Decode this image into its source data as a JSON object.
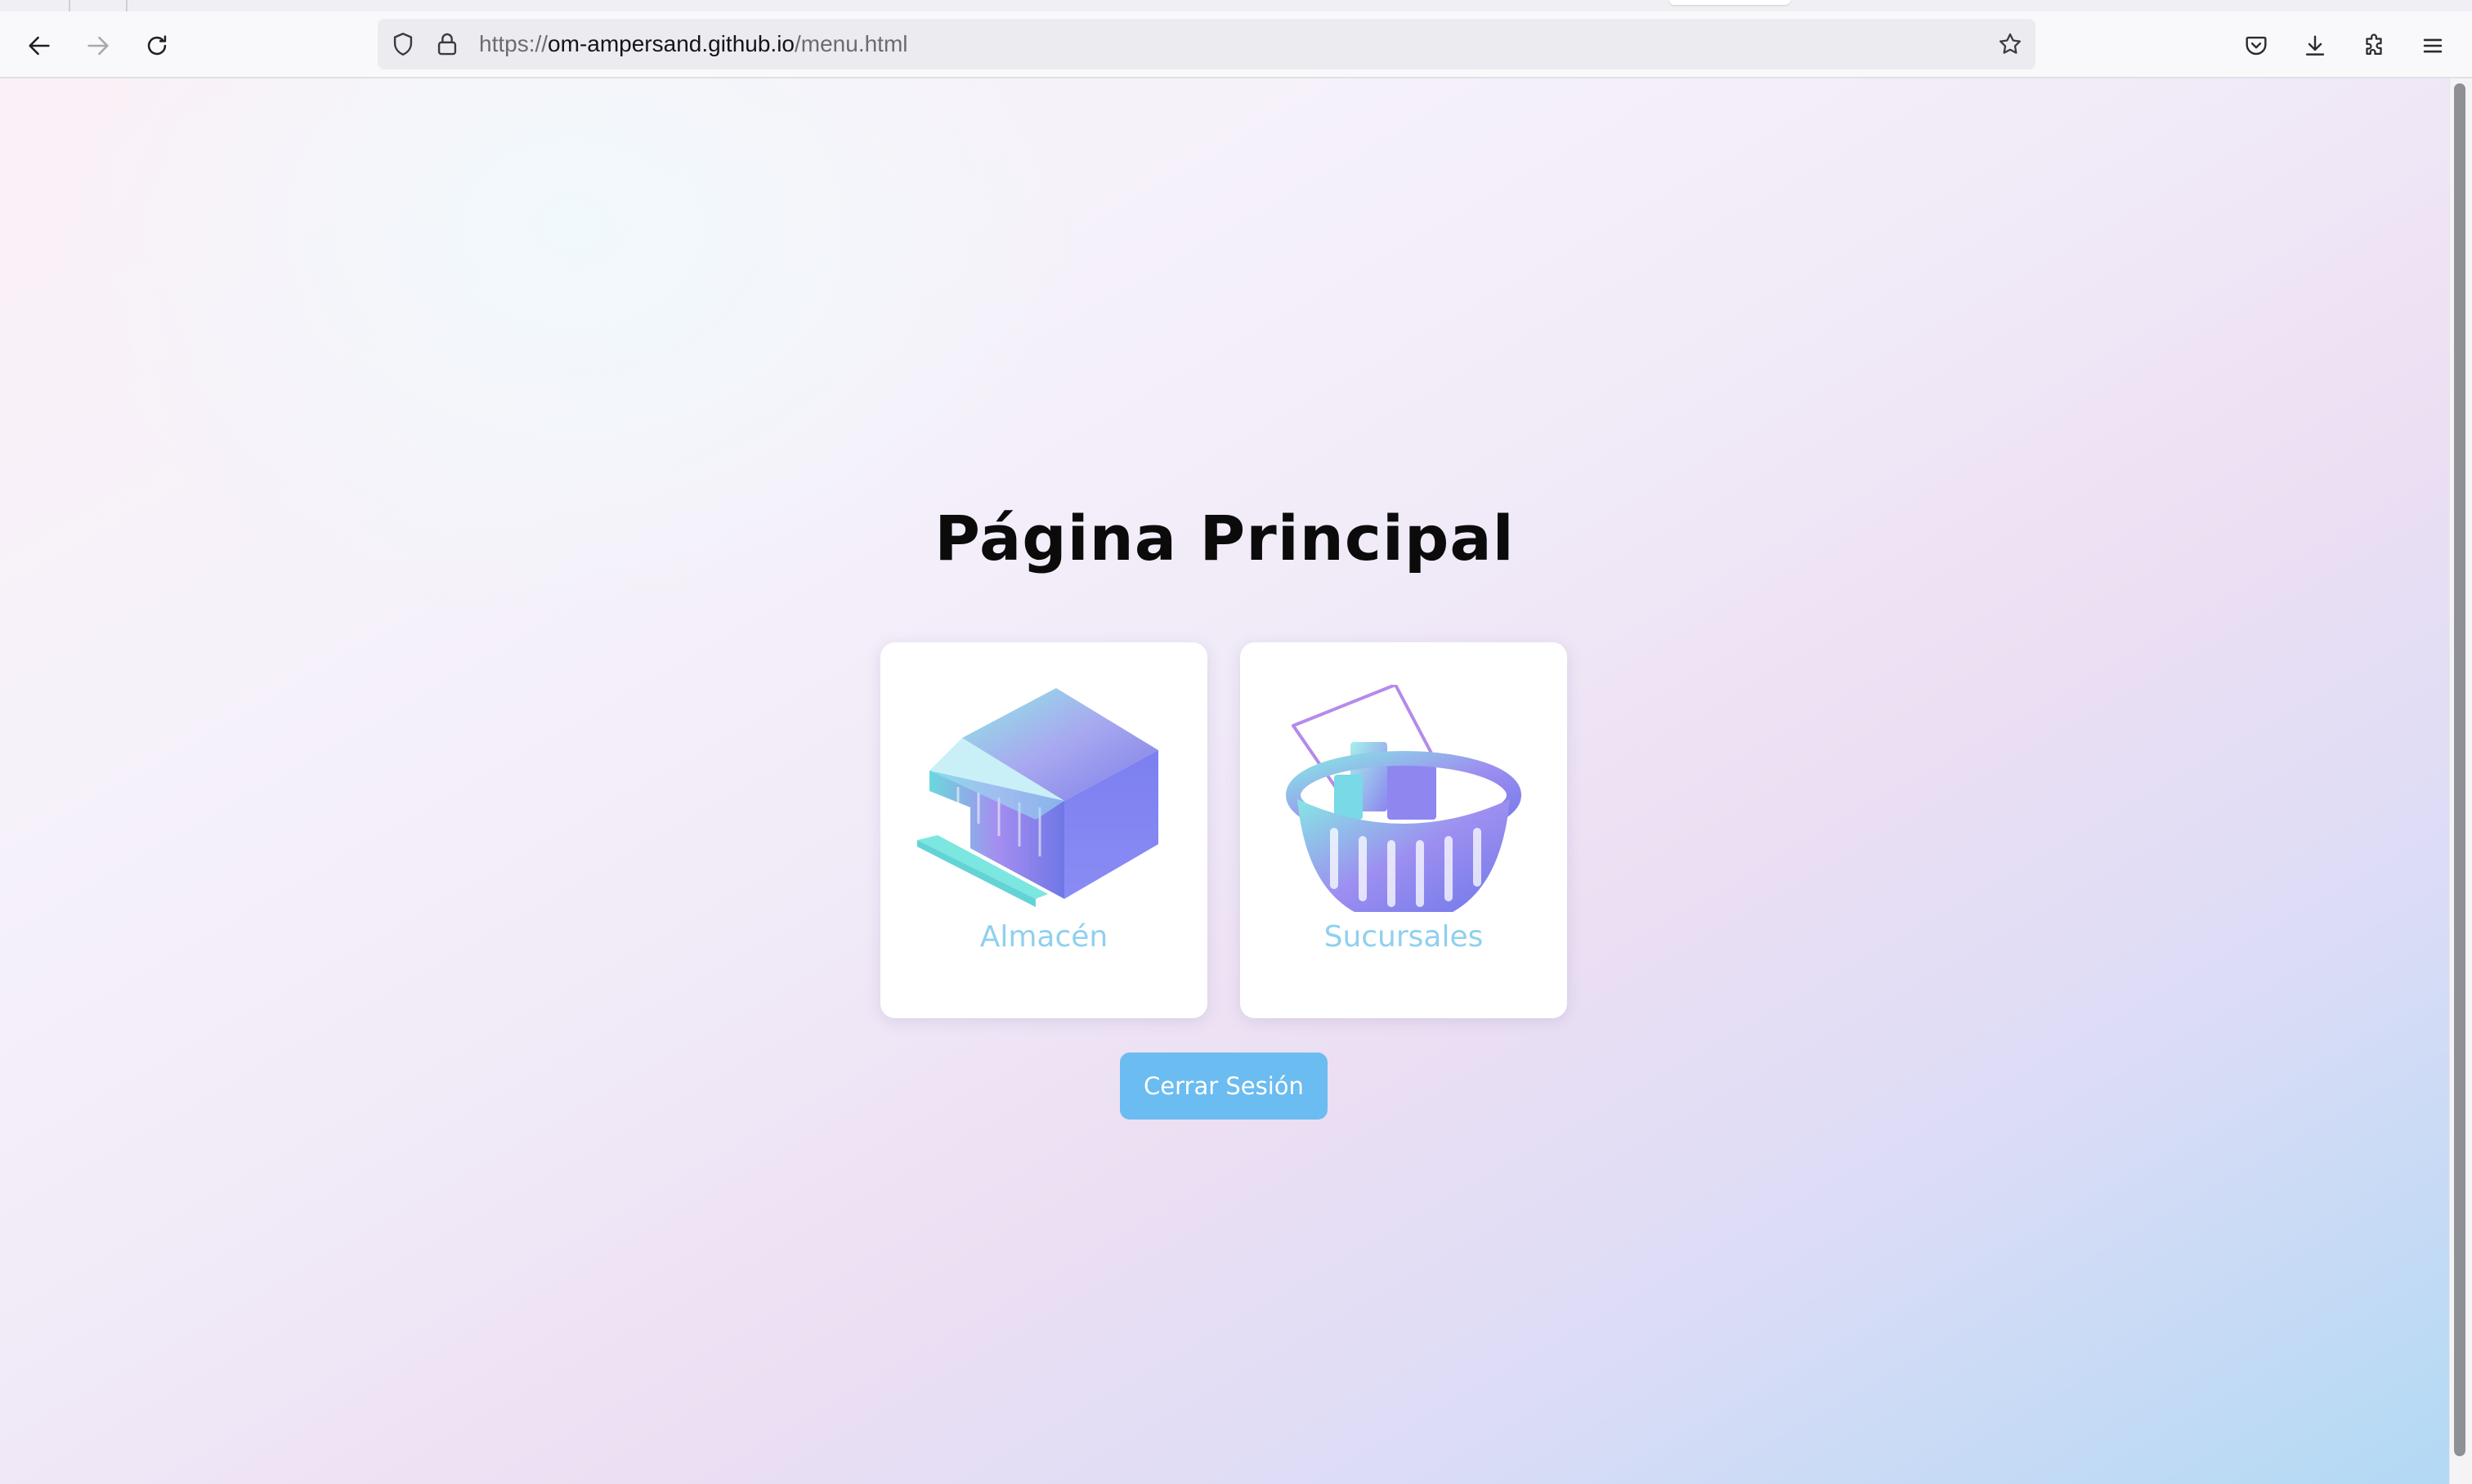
{
  "browser": {
    "url": {
      "scheme": "https://",
      "host": "om-ampersand.github.io",
      "path": "/menu.html"
    },
    "icons": {
      "back": "back-arrow-icon",
      "forward": "forward-arrow-icon",
      "reload": "reload-icon",
      "shield": "tracking-protection-shield-icon",
      "lock": "lock-icon",
      "bookmark": "bookmark-star-icon",
      "pocket": "pocket-icon",
      "downloads": "download-icon",
      "extensions": "extensions-puzzle-icon",
      "menu": "hamburger-menu-icon"
    }
  },
  "page": {
    "title": "Página Principal",
    "cards": [
      {
        "label": "Almacén",
        "icon": "store-building-icon"
      },
      {
        "label": "Sucursales",
        "icon": "shopping-basket-icon"
      }
    ],
    "logout_label": "Cerrar Sesión"
  },
  "colors": {
    "card_label": "#8fd0ee",
    "logout_button": "#6bbcf0",
    "title": "#0b0b0b"
  }
}
